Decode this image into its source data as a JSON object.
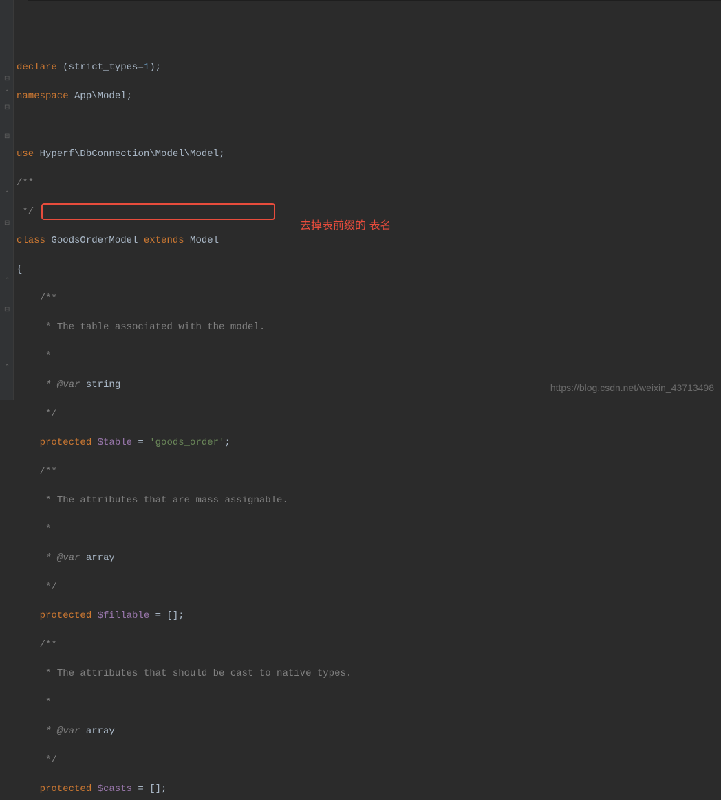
{
  "code": {
    "line1_declare": "declare",
    "line1_strict": "strict_types",
    "line1_eq": "=",
    "line1_val": "1",
    "line1_end": ");",
    "line1_open": " (",
    "line2_ns": "namespace",
    "line2_path": " App\\Model;",
    "line4_use": "use",
    "line4_path": " Hyperf\\DbConnection\\Model\\Model;",
    "line5_doc1": "/**",
    "line6_doc2": " */",
    "line7_class": "class",
    "line7_name": " GoodsOrderModel ",
    "line7_extends": "extends",
    "line7_model": " Model",
    "line8_brace": "{",
    "line9_doc": "    /**",
    "line10_doc": "     * The table associated with the model.",
    "line11_doc": "     *",
    "line12_doc_pre": "     * @var ",
    "line12_doc_type": "string",
    "line13_doc": "     */",
    "line14_prot": "    protected",
    "line14_var": " $table",
    "line14_eq": " = ",
    "line14_str": "'goods_order'",
    "line14_end": ";",
    "line15_doc": "    /**",
    "line16_doc": "     * The attributes that are mass assignable.",
    "line17_doc": "     *",
    "line18_doc_pre": "     * @var ",
    "line18_doc_type": "array",
    "line19_doc": "     */",
    "line20_prot": "    protected",
    "line20_var": " $fillable",
    "line20_eq": " = [];",
    "line21_doc": "    /**",
    "line22_doc": "     * The attributes that should be cast to native types.",
    "line23_doc": "     *",
    "line24_doc_pre": "     * @var ",
    "line24_doc_type": "array",
    "line25_doc": "     */",
    "line26_prot": "    protected",
    "line26_var": " $casts",
    "line26_eq": " = [];"
  },
  "annotation": "去掉表前缀的 表名",
  "watermark": "https://blog.csdn.net/weixin_43713498",
  "fold": {
    "minus": "⊟",
    "up": "⌃"
  }
}
